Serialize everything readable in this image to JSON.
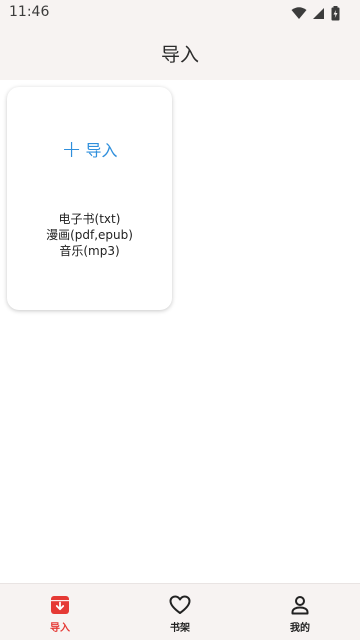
{
  "status": {
    "time": "11:46"
  },
  "header": {
    "title": "导入"
  },
  "import_card": {
    "button_label": "导入",
    "formats": [
      "电子书(txt)",
      "漫画(pdf,epub)",
      "音乐(mp3)"
    ]
  },
  "bottom_nav": {
    "items": [
      {
        "label": "导入",
        "icon": "import-box-icon",
        "active": true
      },
      {
        "label": "书架",
        "icon": "heart-icon",
        "active": false
      },
      {
        "label": "我的",
        "icon": "person-icon",
        "active": false
      }
    ]
  },
  "colors": {
    "accent": "#2f8fdc",
    "active_nav": "#e53935",
    "bar_bg": "#f7f3f2"
  }
}
